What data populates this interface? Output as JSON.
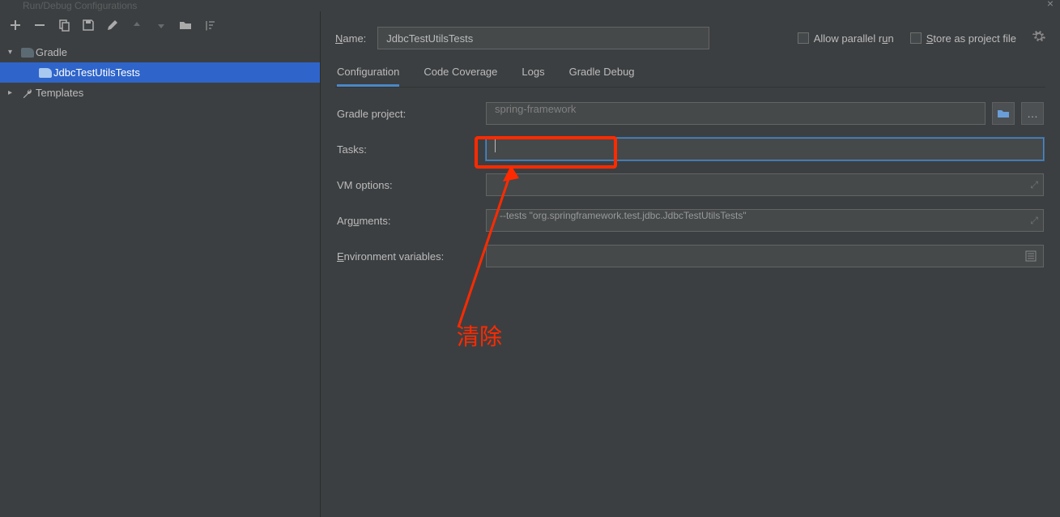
{
  "window": {
    "title": "Run/Debug Configurations"
  },
  "sidebar": {
    "groups": [
      {
        "label": "Gradle",
        "expanded": true,
        "children": [
          {
            "label": "JdbcTestUtilsTests",
            "selected": true
          }
        ]
      },
      {
        "label": "Templates",
        "expanded": false
      }
    ]
  },
  "header": {
    "name_label_pre": "N",
    "name_label_post": "ame:",
    "name_value": "JdbcTestUtilsTests",
    "allow_parallel_pre": "Allow parallel r",
    "allow_parallel_u": "u",
    "allow_parallel_post": "n",
    "store_pre": "S",
    "store_post": "tore as project file"
  },
  "tabs": [
    {
      "label": "Configuration",
      "active": true
    },
    {
      "label": "Code Coverage"
    },
    {
      "label": "Logs"
    },
    {
      "label": "Gradle Debug"
    }
  ],
  "form": {
    "gradle_project": {
      "label": "Gradle project:",
      "value": "spring-framework"
    },
    "tasks": {
      "label": "Tasks:",
      "value": ""
    },
    "vm_options": {
      "label": "VM options:",
      "value": ""
    },
    "arguments": {
      "label_pre": "Arg",
      "label_u": "u",
      "label_post": "ments:",
      "value": "--tests \"org.springframework.test.jdbc.JdbcTestUtilsTests\""
    },
    "env_vars": {
      "label_pre": "E",
      "label_u": "n",
      "label_post": "vironment variables:",
      "value": ""
    }
  },
  "annotation": {
    "text": "清除"
  }
}
